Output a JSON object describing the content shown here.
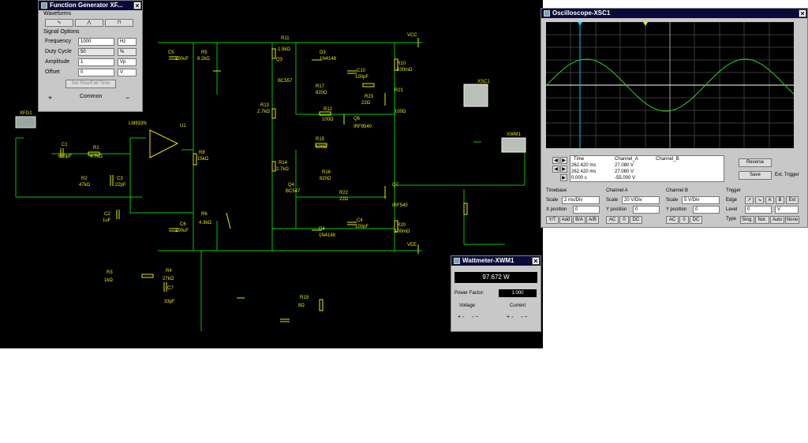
{
  "colors": {
    "canvas": "#000000",
    "wire": "#00c800",
    "component": "#e6e600",
    "trace": "#2ad22a",
    "cursor": "#00c8ff"
  },
  "schematic": {
    "labels": {
      "vcc": "VCC",
      "vee": "VEE",
      "r11": "R11",
      "r11_val": "1.5kΩ",
      "c5": "C5",
      "c5_val": "100uF",
      "r5": "R5",
      "r5_val": "8.2kΩ",
      "r13": "R13",
      "r13_val": "2.7kΩ",
      "q3": "Q3",
      "q3_val": "BC557",
      "d3": "D3",
      "d3_val": "1N4148",
      "r10": "R10",
      "r10_val": "100mΩ",
      "r17": "R17",
      "r17_val": "820Ω",
      "c10": "C10",
      "c10_val": "100pF",
      "r23": "R23",
      "r23_val": "22Ω",
      "r21": "R21",
      "r21_val": "100Ω",
      "r12": "R12",
      "r12_val": "100Ω",
      "q6": "Q6",
      "q6_val": "IRF9540",
      "r8": "R8",
      "r8_val": "15kΩ",
      "u1": "U1",
      "u1_val": "LM833N",
      "xfg1": "XFG1",
      "c1": "C1",
      "c1_val": "680pF",
      "r1": "R1",
      "r1_val": "4.7kΩ",
      "r2": "R2",
      "r2_val": "47kΩ",
      "c3": "C3",
      "c3_val": "22pF",
      "c2": "C2",
      "c2_val": "1uF",
      "r14": "R14",
      "r14_val": "2.7kΩ",
      "q4": "Q4",
      "q4_val": "BC547",
      "r15": "R15",
      "r15_val": "100Ω",
      "r16": "R16",
      "r16_val": "820Ω",
      "r22": "R22",
      "r22_val": "22Ω",
      "q7": "Q7",
      "q7_val": "IRF540",
      "c4": "C4",
      "c4_val": "100pF",
      "d4": "D4",
      "d4_val": "1N4148",
      "r20": "R20",
      "r20_val": "100mΩ",
      "r6": "R6",
      "r6_val": "4.3kΩ",
      "c6": "C6",
      "c6_val": "100uF",
      "r3": "R3",
      "r3_val": "1kΩ",
      "r4": "R4",
      "r4_val": "27kΩ",
      "c7": "C7",
      "c7_val": "33pF",
      "r19": "R19",
      "r19_val": "8Ω",
      "xsc1": "XSC1",
      "xwm1": "XWM1"
    }
  },
  "function_generator": {
    "title": "Function Generator XF...",
    "section_waveforms": "Waveforms",
    "section_signal": "Signal Options",
    "rows": [
      {
        "label": "Frequency",
        "value": "1000",
        "unit": "Hz"
      },
      {
        "label": "Duty Cycle",
        "value": "50",
        "unit": "%"
      },
      {
        "label": "Amplitude",
        "value": "1",
        "unit": "Vp"
      },
      {
        "label": "Offset",
        "value": "0",
        "unit": "V"
      }
    ],
    "set_rise_fall": "Set Rise/Fall Time",
    "plus": "+",
    "common": "Common",
    "minus": "−"
  },
  "oscilloscope": {
    "title": "Oscilloscope-XSC1",
    "readout_headers": [
      "Time",
      "Channel_A",
      "Channel_B"
    ],
    "readout_rows": [
      [
        "262.420 ms",
        "27.080 V",
        ""
      ],
      [
        "262.420 ms",
        "27.080 V",
        ""
      ],
      [
        "0.000 s",
        "-55.000 V",
        ""
      ]
    ],
    "reverse": "Reverse",
    "save": "Save",
    "ext_trigger": "Ext. Trigger",
    "timebase": {
      "title": "Timebase",
      "scale_label": "Scale",
      "scale": "2 ms/Div",
      "xpos_label": "X position",
      "xpos": "0",
      "modes": [
        "Y/T",
        "Add",
        "B/A",
        "A/B"
      ]
    },
    "channel_a": {
      "title": "Channel A",
      "scale_label": "Scale",
      "scale": "20 V/Div",
      "ypos_label": "Y position",
      "ypos": "0",
      "modes": [
        "AC",
        "0",
        "DC"
      ]
    },
    "channel_b": {
      "title": "Channel B",
      "scale_label": "Scale",
      "scale": "5 V/Div",
      "ypos_label": "Y position",
      "ypos": "0",
      "modes": [
        "AC",
        "0",
        "DC"
      ]
    },
    "trigger": {
      "title": "Trigger",
      "edge_label": "Edge",
      "level_label": "Level",
      "level": "0",
      "level_unit": "V",
      "type_label": "Type",
      "types": [
        "Sing.",
        "Nor.",
        "Auto",
        "None"
      ]
    }
  },
  "wattmeter": {
    "title": "Wattmeter-XWM1",
    "reading": "97.672 W",
    "pf_label": "Power Factor:",
    "pf_value": "1.000",
    "voltage_label": "Voltage",
    "current_label": "Current"
  }
}
